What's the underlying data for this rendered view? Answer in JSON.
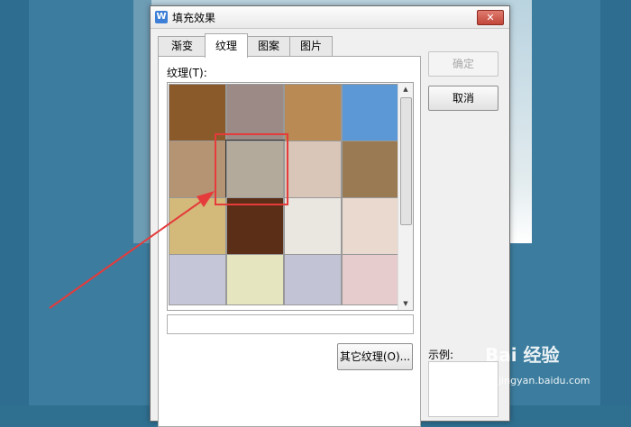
{
  "dialog": {
    "title": "填充效果",
    "close_label": "✕"
  },
  "tabs": [
    {
      "label": "渐变",
      "active": false
    },
    {
      "label": "纹理",
      "active": true
    },
    {
      "label": "图案",
      "active": false
    },
    {
      "label": "图片",
      "active": false
    }
  ],
  "texture_panel": {
    "label": "纹理(T):",
    "textures": [
      {
        "name": "brown-leather-texture",
        "color": "#8b5a2b"
      },
      {
        "name": "woven-fiber-texture",
        "color": "#9b8a86"
      },
      {
        "name": "burlap-texture",
        "color": "#b98a54"
      },
      {
        "name": "blue-tissue-texture",
        "color": "#5c97d6"
      },
      {
        "name": "sand-texture",
        "color": "#b59473"
      },
      {
        "name": "granite-texture",
        "color": "#b3aa9c",
        "selected": true
      },
      {
        "name": "pink-stripes-texture",
        "color": "#d9c6b8"
      },
      {
        "name": "brown-dots-texture",
        "color": "#9a7a52"
      },
      {
        "name": "golden-grain-texture",
        "color": "#d3ba7a"
      },
      {
        "name": "leopard-texture",
        "color": "#5b2e17"
      },
      {
        "name": "paper-text-texture",
        "color": "#eae6e0"
      },
      {
        "name": "vertical-fibers-texture",
        "color": "#ead9cf"
      },
      {
        "name": "blue-stripe-fabric-texture",
        "color": "#c5c6d8"
      },
      {
        "name": "yellow-grid-texture",
        "color": "#e5e5bf"
      },
      {
        "name": "gray-plaid-texture",
        "color": "#c2c4d6"
      },
      {
        "name": "pink-plaid-texture",
        "color": "#e6cccc"
      }
    ],
    "name_field_value": "",
    "other_texture_label": "其它纹理(O)..."
  },
  "buttons": {
    "ok_label": "确定",
    "cancel_label": "取消"
  },
  "sample_label": "示例:",
  "watermark": {
    "brand": "Bai 经验",
    "url": "jingyan.baidu.com"
  }
}
